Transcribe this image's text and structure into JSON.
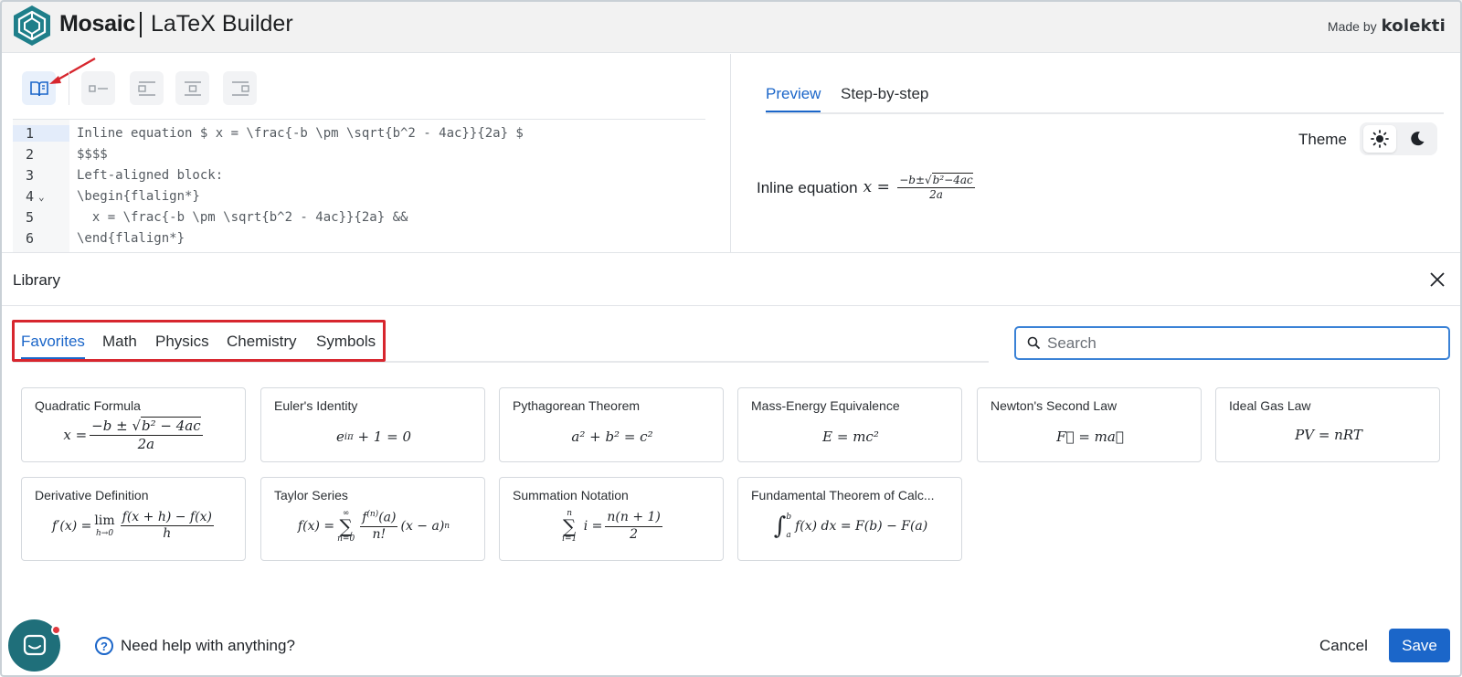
{
  "header": {
    "brand": "Mosaic",
    "subtitle": "LaTeX Builder",
    "made_by_prefix": "Made by",
    "made_by_brand": "kolekti"
  },
  "toolbar": {
    "buttons": [
      {
        "name": "library-toggle",
        "icon": "book-icon",
        "active": true
      },
      {
        "name": "inline-align",
        "icon": "inline-icon",
        "active": false
      },
      {
        "name": "align-left",
        "icon": "align-left-icon",
        "active": false
      },
      {
        "name": "align-center",
        "icon": "align-center-icon",
        "active": false
      },
      {
        "name": "align-right",
        "icon": "align-right-icon",
        "active": false
      }
    ]
  },
  "editor": {
    "lines": [
      {
        "n": "1",
        "text": "Inline equation $ x = \\frac{-b \\pm \\sqrt{b^2 - 4ac}}{2a} $"
      },
      {
        "n": "2",
        "text": "$$$$"
      },
      {
        "n": "3",
        "text": "Left-aligned block:"
      },
      {
        "n": "4",
        "text": "\\begin{flalign*}"
      },
      {
        "n": "5",
        "text": "  x = \\frac{-b \\pm \\sqrt{b^2 - 4ac}}{2a} &&"
      },
      {
        "n": "6",
        "text": "\\end{flalign*}"
      }
    ]
  },
  "preview": {
    "tabs": [
      {
        "label": "Preview",
        "active": true
      },
      {
        "label": "Step-by-step",
        "active": false
      }
    ],
    "theme_label": "Theme",
    "output_text": "Inline equation"
  },
  "library": {
    "title": "Library",
    "tabs": [
      {
        "label": "Favorites",
        "active": true
      },
      {
        "label": "Math",
        "active": false
      },
      {
        "label": "Physics",
        "active": false
      },
      {
        "label": "Chemistry",
        "active": false
      },
      {
        "label": "Symbols",
        "active": false
      }
    ],
    "search_placeholder": "Search",
    "cards": [
      {
        "title": "Quadratic Formula"
      },
      {
        "title": "Euler's Identity"
      },
      {
        "title": "Pythagorean Theorem"
      },
      {
        "title": "Mass-Energy Equivalence"
      },
      {
        "title": "Newton's Second Law"
      },
      {
        "title": "Ideal Gas Law"
      },
      {
        "title": "Derivative Definition"
      },
      {
        "title": "Taylor Series"
      },
      {
        "title": "Summation Notation"
      },
      {
        "title": "Fundamental Theorem of Calc..."
      }
    ]
  },
  "footer": {
    "help_text": "Need help with anything?",
    "cancel_label": "Cancel",
    "save_label": "Save"
  },
  "colors": {
    "accent": "#1b66c9",
    "highlight_red": "#d7262e",
    "chat_bubble": "#1f6f7a"
  }
}
